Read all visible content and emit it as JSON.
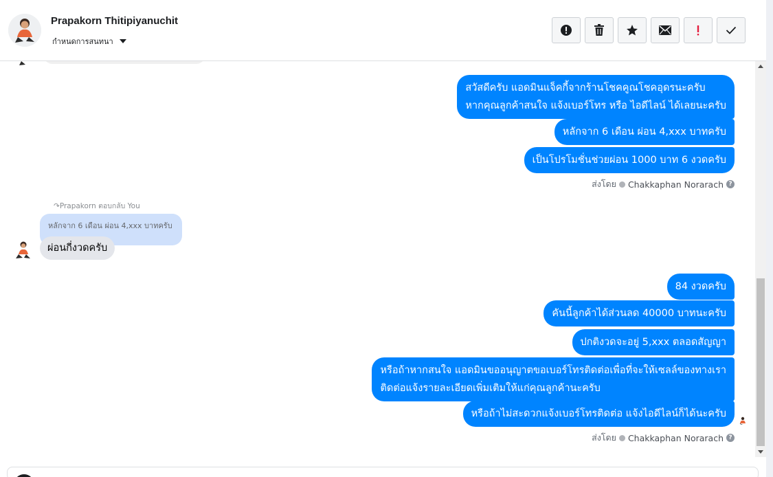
{
  "header": {
    "contact_name": "Prapakorn Thitipiyanuchit",
    "assign_label": "กำหนดการสนทนา",
    "actions": [
      {
        "name": "spam-button",
        "icon": "alert-circle-icon"
      },
      {
        "name": "delete-button",
        "icon": "trash-icon"
      },
      {
        "name": "star-button",
        "icon": "star-icon"
      },
      {
        "name": "mark-unread-button",
        "icon": "envelope-icon"
      },
      {
        "name": "follow-up-button",
        "icon": "exclamation-icon"
      },
      {
        "name": "mark-done-button",
        "icon": "check-icon"
      }
    ]
  },
  "thread": {
    "group1": {
      "messages": [
        [
          "สวัสดีครับ แอดมินแจ็คกี้จากร้านโชคคูณโชคอุดรนะครับ",
          "หากคุณลูกค้าสนใจ แจ้งเบอร์โทร หรือ ไอดีไลน์ ได้เลยนะครับ"
        ],
        [
          "หลักจาก 6 เดือน ผ่อน 4,xxx บาทครับ"
        ],
        [
          "เป็นโปรโมชั่นช่วยผ่อน 1000 บาท 6 งวดครับ"
        ]
      ],
      "sent_by_label": "ส่งโดย",
      "agent": "Chakkaphan Norarach"
    },
    "incoming": {
      "reply_label": "Prapakorn ตอบกลับ You",
      "quoted_text": "หลักจาก 6 เดือน ผ่อน 4,xxx บาทครับ",
      "message": "ผ่อนกี่งวดครับ"
    },
    "group2": {
      "messages": [
        [
          "84 งวดครับ"
        ],
        [
          "คันนี้ลูกค้าได้ส่วนลด 40000 บาทนะครับ"
        ],
        [
          "ปกติงวดจะอยู่ 5,xxx ตลอดสัญญา"
        ],
        [
          "หรือถ้าหากสนใจ แอดมินขออนุญาตขอเบอร์โทรติดต่อเพื่อที่จะให้เซลล์ของทางเรา",
          "ติดต่อแจ้งรายละเอียดเพิ่มเติมให้แก่คุณลูกค้านะครับ"
        ],
        [
          "หรือถ้าไม่สะดวกแจ้งเบอร์โทรติดต่อ แจ้งไอดีไลน์ก็ได้นะครับ"
        ]
      ],
      "sent_by_label": "ส่งโดย",
      "agent": "Chakkaphan Norarach"
    }
  },
  "colors": {
    "outgoing_bubble": "#0084ff",
    "incoming_bubble": "#e4e6eb",
    "quoted_bubble": "#cfe0fb"
  }
}
